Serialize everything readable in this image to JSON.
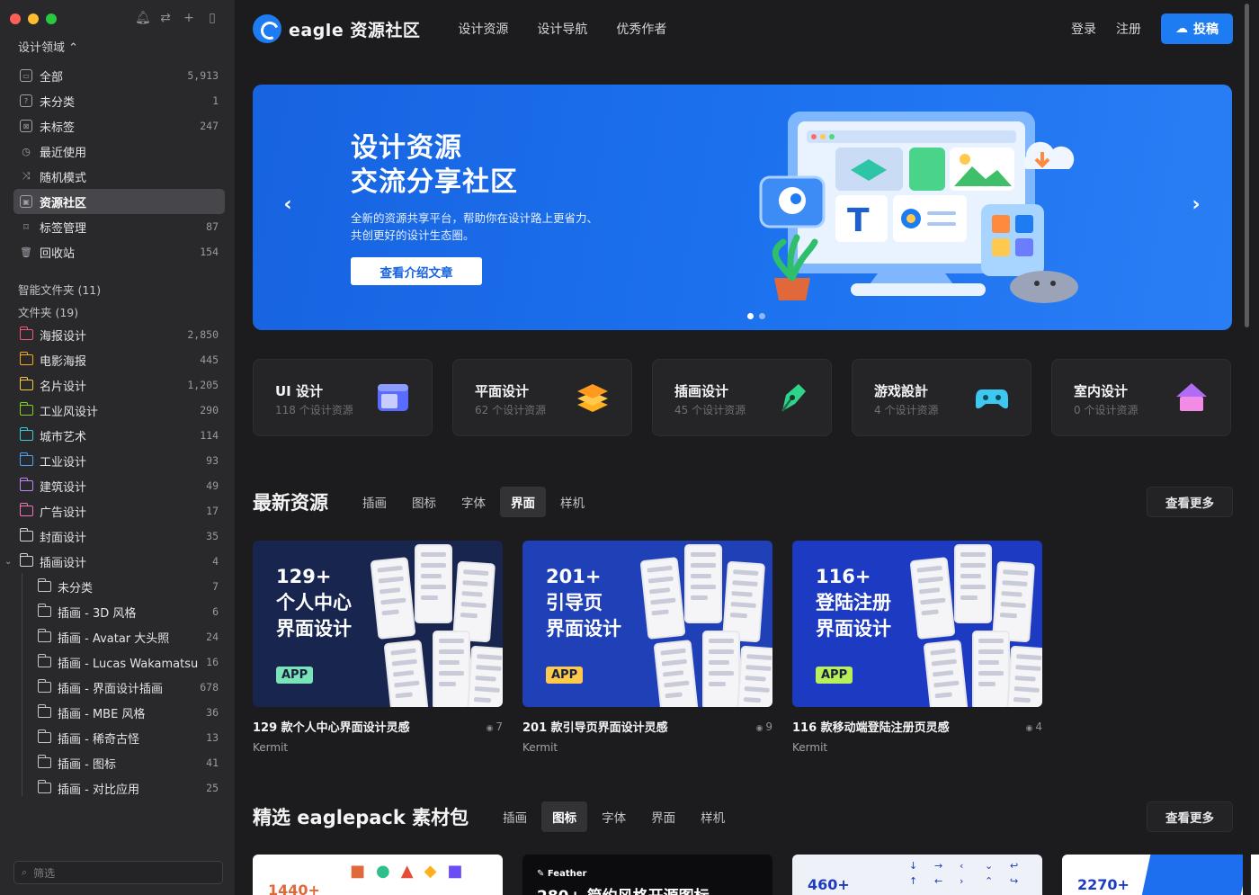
{
  "sidebar": {
    "domain_label": "设计领域 ⌃",
    "items": [
      {
        "label": "全部",
        "count": "5,913",
        "icon": "all-items-icon"
      },
      {
        "label": "未分类",
        "count": "1",
        "icon": "uncategorized-icon"
      },
      {
        "label": "未标签",
        "count": "247",
        "icon": "untagged-icon"
      },
      {
        "label": "最近使用",
        "count": "",
        "icon": "clock-icon"
      },
      {
        "label": "随机模式",
        "count": "",
        "icon": "shuffle-icon"
      },
      {
        "label": "资源社区",
        "count": "",
        "icon": "community-icon"
      },
      {
        "label": "标签管理",
        "count": "87",
        "icon": "tag-icon"
      },
      {
        "label": "回收站",
        "count": "154",
        "icon": "trash-icon"
      }
    ],
    "smart_folders": "智能文件夹 (11)",
    "folders_title": "文件夹 (19)",
    "folders": [
      {
        "label": "海报设计",
        "count": "2,850",
        "color": "#f0567a"
      },
      {
        "label": "电影海报",
        "count": "445",
        "color": "#f5a623"
      },
      {
        "label": "名片设计",
        "count": "1,205",
        "color": "#f5c842"
      },
      {
        "label": "工业风设计",
        "count": "290",
        "color": "#7ed321"
      },
      {
        "label": "城市艺术",
        "count": "114",
        "color": "#3bc9db"
      },
      {
        "label": "工业设计",
        "count": "93",
        "color": "#4aa3f7"
      },
      {
        "label": "建筑设计",
        "count": "49",
        "color": "#c084fc"
      },
      {
        "label": "广告设计",
        "count": "17",
        "color": "#f472b6"
      },
      {
        "label": "封面设计",
        "count": "35",
        "color": "#d4d4d8"
      },
      {
        "label": "插画设计",
        "count": "4",
        "color": "#d4d4d8"
      }
    ],
    "subfolders": [
      {
        "label": "未分类",
        "count": "7"
      },
      {
        "label": "插画 - 3D 风格",
        "count": "6"
      },
      {
        "label": "插画 - Avatar 大头照",
        "count": "24"
      },
      {
        "label": "插画 - Lucas Wakamatsu",
        "count": "16"
      },
      {
        "label": "插画 - 界面设计插画",
        "count": "678"
      },
      {
        "label": "插画 - MBE 风格",
        "count": "36"
      },
      {
        "label": "插画 - 稀奇古怪",
        "count": "13"
      },
      {
        "label": "插画 - 图标",
        "count": "41"
      },
      {
        "label": "插画 - 对比应用",
        "count": "25"
      }
    ],
    "filter_placeholder": "筛选"
  },
  "header": {
    "brand": "eagle 资源社区",
    "nav": [
      "设计资源",
      "设计导航",
      "优秀作者"
    ],
    "login": "登录",
    "register": "注册",
    "submit": "投稿"
  },
  "banner": {
    "title_line1": "设计资源",
    "title_line2": "交流分享社区",
    "desc_line1": "全新的资源共享平台，帮助你在设计路上更省力、",
    "desc_line2": "共创更好的设计生态圈。",
    "button": "查看介绍文章",
    "active_slide": 1,
    "slide_count": 2
  },
  "categories": [
    {
      "name": "UI 设计",
      "sub": "118 个设计资源",
      "color": "#6b7cff"
    },
    {
      "name": "平面设计",
      "sub": "62 个设计资源",
      "color": "#ffb020"
    },
    {
      "name": "插画设计",
      "sub": "45 个设计资源",
      "color": "#2fd48a"
    },
    {
      "name": "游戏設計",
      "sub": "4 个设计资源",
      "color": "#3dc8f0"
    },
    {
      "name": "室内设计",
      "sub": "0 个设计资源",
      "color": "#d86cf5"
    }
  ],
  "latest": {
    "title": "最新资源",
    "tabs": [
      "插画",
      "图标",
      "字体",
      "界面",
      "样机"
    ],
    "active_tab": "界面",
    "more": "查看更多",
    "cards": [
      {
        "line1": "129+",
        "line2": "个人中心",
        "line3": "界面设计",
        "tag": "APP",
        "tag_color": "#7be3b8",
        "bg": "#17254f",
        "title": "129 款个人中心界面设计灵感",
        "views": "7",
        "author": "Kermit"
      },
      {
        "line1": "201+",
        "line2": "引导页",
        "line3": "界面设计",
        "tag": "APP",
        "tag_color": "#ffc94d",
        "bg": "#2040b8",
        "title": "201 款引导页界面设计灵感",
        "views": "9",
        "author": "Kermit"
      },
      {
        "line1": "116+",
        "line2": "登陆注册",
        "line3": "界面设计",
        "tag": "APP",
        "tag_color": "#b8f05a",
        "bg": "#1d3bc2",
        "title": "116 款移动端登陆注册页灵感",
        "views": "4",
        "author": "Kermit"
      }
    ]
  },
  "packs": {
    "title": "精选 eaglepack 素材包",
    "tabs": [
      "插画",
      "图标",
      "字体",
      "界面",
      "样机"
    ],
    "active_tab": "图标",
    "more": "查看更多",
    "items": [
      {
        "text": "1440+"
      },
      {
        "brand": "Feather",
        "text": "280+ 简约风格开源图标"
      },
      {
        "text": "460+"
      },
      {
        "text": "2270+"
      }
    ]
  }
}
